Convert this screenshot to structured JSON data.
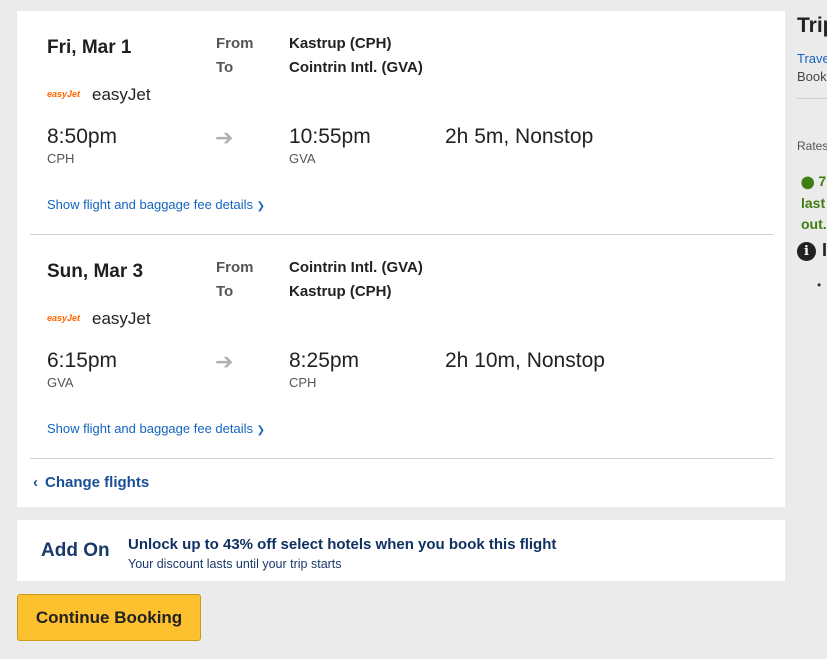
{
  "flights": [
    {
      "date": "Fri, Mar 1",
      "from_label": "From",
      "to_label": "To",
      "from": "Kastrup (CPH)",
      "to": "Cointrin Intl. (GVA)",
      "airline_logo": "easyJet",
      "airline": "easyJet",
      "depart_time": "8:50pm",
      "depart_code": "CPH",
      "arrive_time": "10:55pm",
      "arrive_code": "GVA",
      "duration": "2h 5m, Nonstop",
      "details_link": "Show flight and baggage fee details"
    },
    {
      "date": "Sun, Mar 3",
      "from_label": "From",
      "to_label": "To",
      "from": "Cointrin Intl. (GVA)",
      "to": "Kastrup (CPH)",
      "airline_logo": "easyJet",
      "airline": "easyJet",
      "depart_time": "6:15pm",
      "depart_code": "GVA",
      "arrive_time": "8:25pm",
      "arrive_code": "CPH",
      "duration": "2h 10m, Nonstop",
      "details_link": "Show flight and baggage fee details"
    }
  ],
  "change_flights": "Change flights",
  "addon": {
    "logo": "Add On",
    "title": "Unlock up to 43% off select hotels when you book this flight",
    "subtitle": "Your discount lasts until your trip starts"
  },
  "continue_button": "Continue Booking",
  "sidebar": {
    "title": "Trip",
    "link": "Trave",
    "sub": "Book",
    "rates": "Rates",
    "green_line1": "7",
    "green_line2": "last",
    "green_line3": "out.",
    "info_text": "I"
  },
  "colors": {
    "accent_link": "#1565c0",
    "button_yellow": "#fdc02f",
    "brand_navy": "#1a3a6b",
    "status_green": "#3e7e10"
  }
}
